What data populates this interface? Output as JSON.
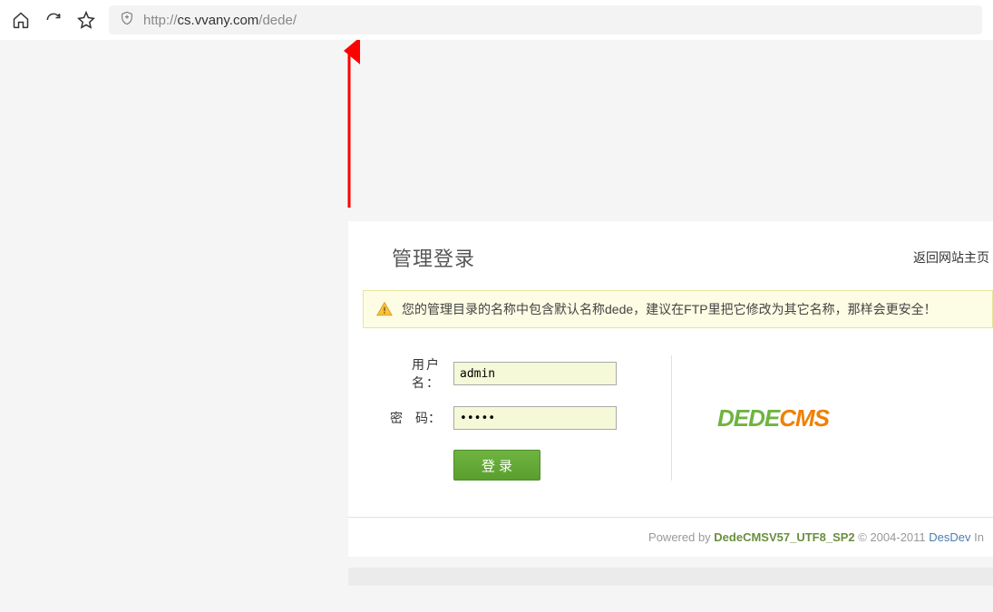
{
  "browser": {
    "url_prefix": "http://",
    "url_domain": "cs.vvany.com",
    "url_path": "/dede/"
  },
  "annotation": {
    "arrow_color": "#ff0000"
  },
  "login": {
    "title": "管理登录",
    "return_link": "返回网站主页",
    "warning": "您的管理目录的名称中包含默认名称dede，建议在FTP里把它修改为其它名称，那样会更安全！",
    "username_label": "用户名：",
    "password_label": "密　码：",
    "username_value": "admin",
    "password_value": "•••••",
    "submit_label": "登录"
  },
  "logo": {
    "part1": "DEDE",
    "part2": "CMS"
  },
  "footer": {
    "powered": "Powered by ",
    "product": "DedeCMSV57_UTF8_SP2",
    "copyright": " © 2004-2011 ",
    "company": "DesDev",
    "suffix": " In"
  }
}
